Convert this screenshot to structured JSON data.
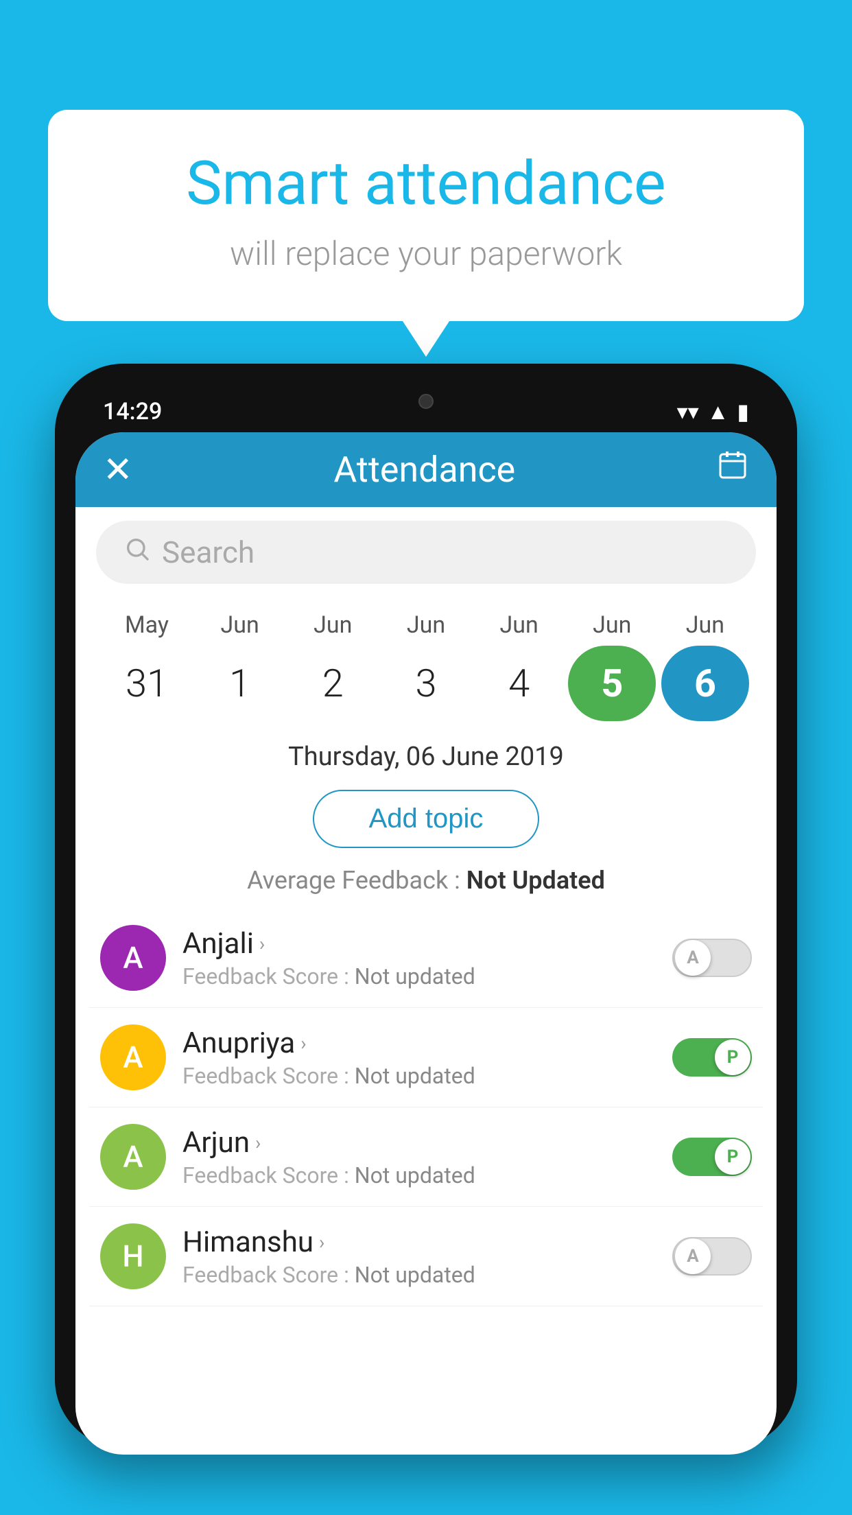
{
  "background_color": "#1ab8e8",
  "speech_bubble": {
    "title": "Smart attendance",
    "subtitle": "will replace your paperwork"
  },
  "phone": {
    "status_bar": {
      "time": "14:29"
    },
    "header": {
      "title": "Attendance",
      "close_label": "✕",
      "calendar_icon": "📅"
    },
    "search": {
      "placeholder": "Search"
    },
    "calendar": {
      "months": [
        "May",
        "Jun",
        "Jun",
        "Jun",
        "Jun",
        "Jun",
        "Jun"
      ],
      "days": [
        "31",
        "1",
        "2",
        "3",
        "4",
        "5",
        "6"
      ],
      "day_states": [
        "normal",
        "normal",
        "normal",
        "normal",
        "normal",
        "today",
        "selected"
      ]
    },
    "selected_date": "Thursday, 06 June 2019",
    "add_topic_label": "Add topic",
    "avg_feedback_label": "Average Feedback : ",
    "avg_feedback_value": "Not Updated",
    "students": [
      {
        "name": "Anjali",
        "initial": "A",
        "avatar_color": "#9c27b0",
        "feedback_label": "Feedback Score : ",
        "feedback_value": "Not updated",
        "toggle_state": "off",
        "toggle_letter": "A"
      },
      {
        "name": "Anupriya",
        "initial": "A",
        "avatar_color": "#ffc107",
        "feedback_label": "Feedback Score : ",
        "feedback_value": "Not updated",
        "toggle_state": "on",
        "toggle_letter": "P"
      },
      {
        "name": "Arjun",
        "initial": "A",
        "avatar_color": "#8bc34a",
        "feedback_label": "Feedback Score : ",
        "feedback_value": "Not updated",
        "toggle_state": "on",
        "toggle_letter": "P"
      },
      {
        "name": "Himanshu",
        "initial": "H",
        "avatar_color": "#8bc34a",
        "feedback_label": "Feedback Score : ",
        "feedback_value": "Not updated",
        "toggle_state": "off",
        "toggle_letter": "A"
      }
    ]
  }
}
